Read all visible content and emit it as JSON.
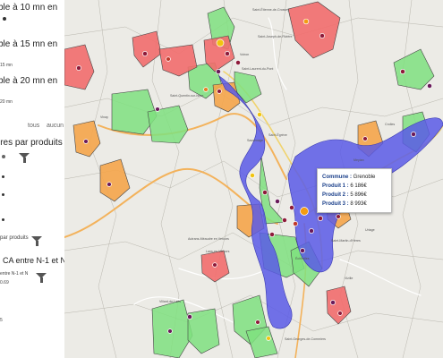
{
  "sidebar": {
    "legend_items": [
      {
        "label": "ble à 10 mn en",
        "sub": ""
      },
      {
        "label": "ble à 15 mn en",
        "sub": "15 mn"
      },
      {
        "label": "ble à 20 mn en",
        "sub": "20 mn"
      }
    ],
    "select_all": "tous",
    "select_none": "aucun",
    "products_section": "ires par produits",
    "products_filter_label": "par produits",
    "ca_section": "CA entre N-1 et N",
    "ca_sub": "entre N-1 et N",
    "ca_value": "0.69",
    "ca_digit": "5"
  },
  "tooltip": {
    "commune_label": "Commune :",
    "commune_value": "Grenoble",
    "rows": [
      {
        "label": "Produit 1 :",
        "value": "6 186€"
      },
      {
        "label": "Produit 2 :",
        "value": "5 896€"
      },
      {
        "label": "Produit 3 :",
        "value": "8 993€"
      }
    ]
  },
  "map": {
    "colors": {
      "zone_green": "#7fe07f",
      "zone_orange": "#f5a54a",
      "zone_red": "#f26d6d",
      "isochrone_blue": "#5a5ae6",
      "road_orange": "#f3b25b",
      "road_yellow": "#f0d36d",
      "road_white": "#ffffff",
      "map_bg": "#ecebe6",
      "commune_border": "#b8b6ad"
    },
    "place_labels": [
      "Saint-Étienne-de-Crossey",
      "Saint-Joseph-de-Rivière",
      "Voiron",
      "Saint-Laurent-du-Pont",
      "Vinay",
      "Saint-Quentin-sur-Isère",
      "Sassenage",
      "Saint-Égrève",
      "Meylan",
      "Crolles",
      "Saint-Martin-d'Hères",
      "Échirolles",
      "Vizille",
      "Saint-Georges-de-Commiers",
      "Villard-de-Lans",
      "Autrans-Méaudre en Vercors",
      "Lans-en-Vercors",
      "Uriage"
    ]
  }
}
